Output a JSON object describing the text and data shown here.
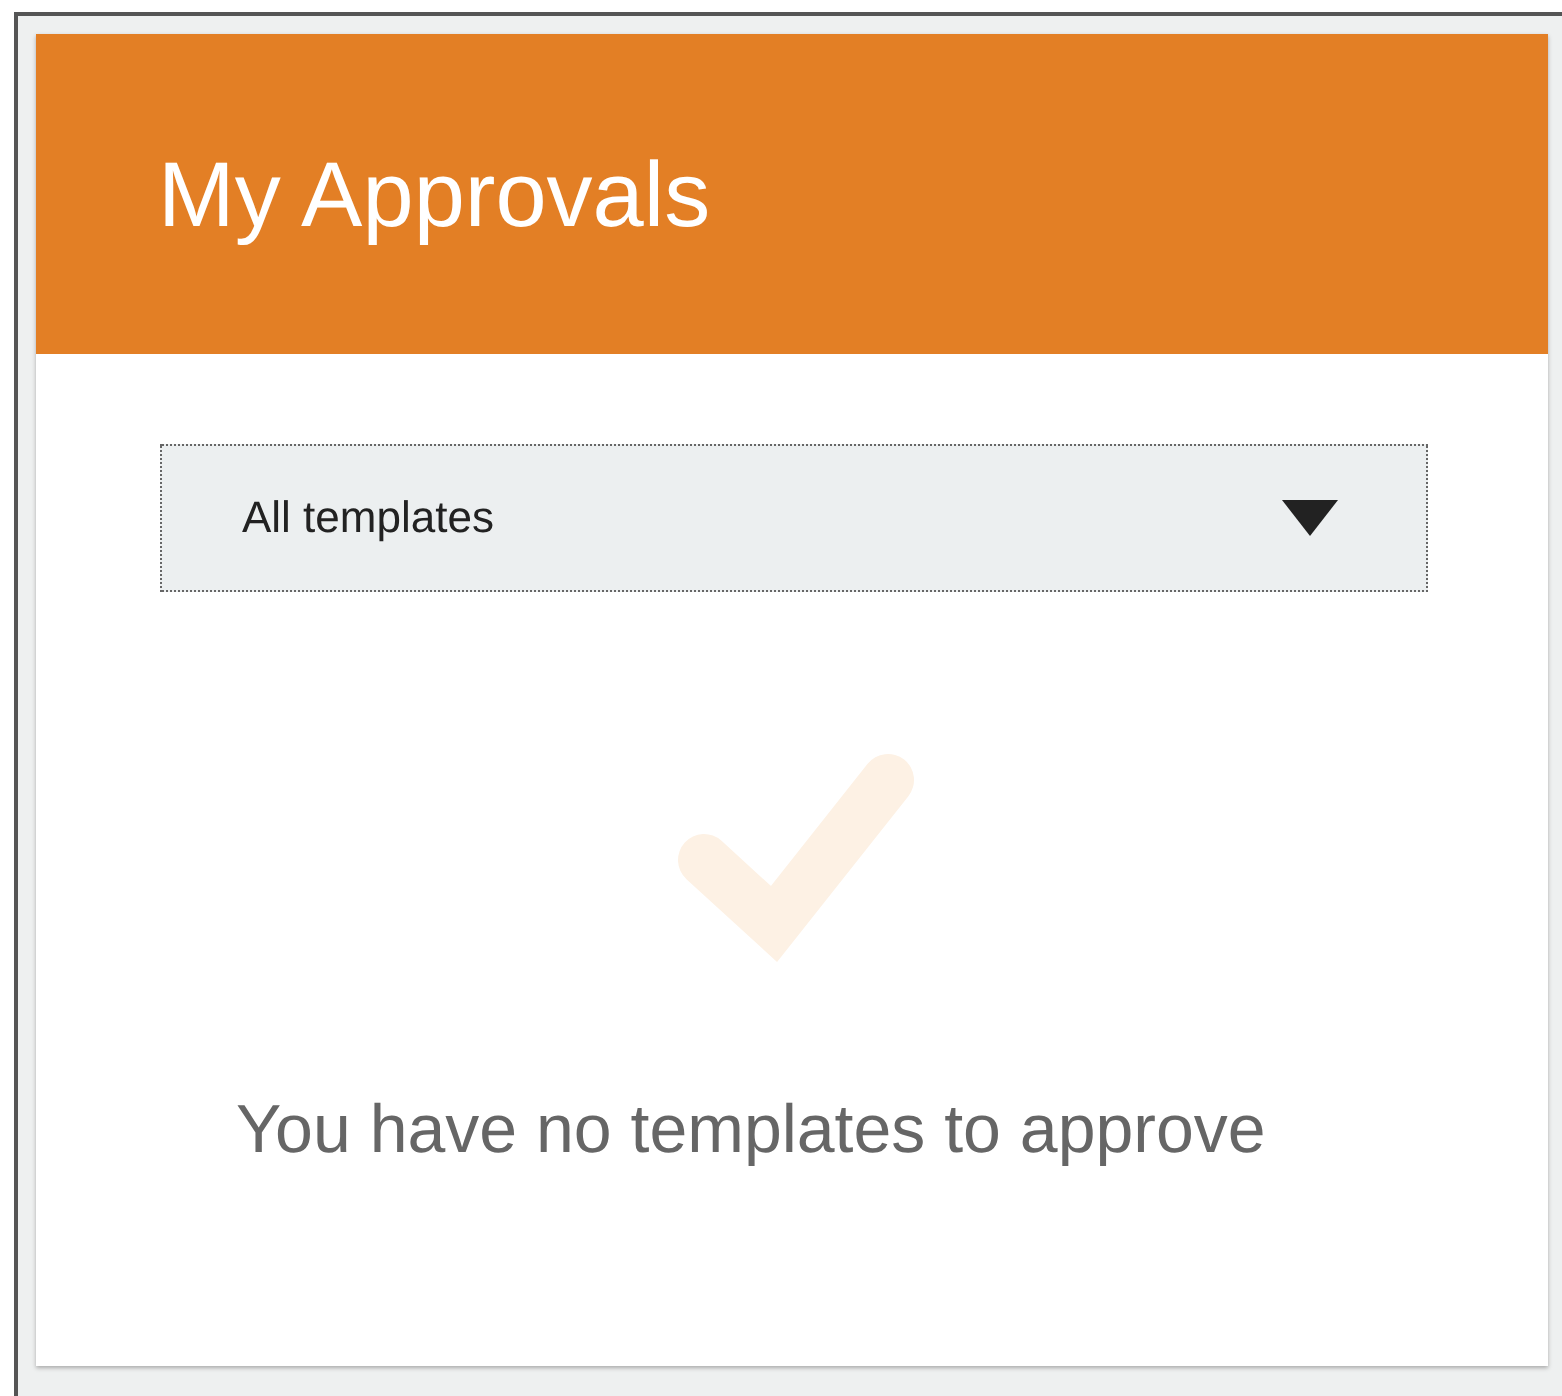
{
  "header": {
    "title": "My Approvals"
  },
  "filter": {
    "value": "All templates"
  },
  "empty_state": {
    "message": "You have no templates to approve"
  }
}
